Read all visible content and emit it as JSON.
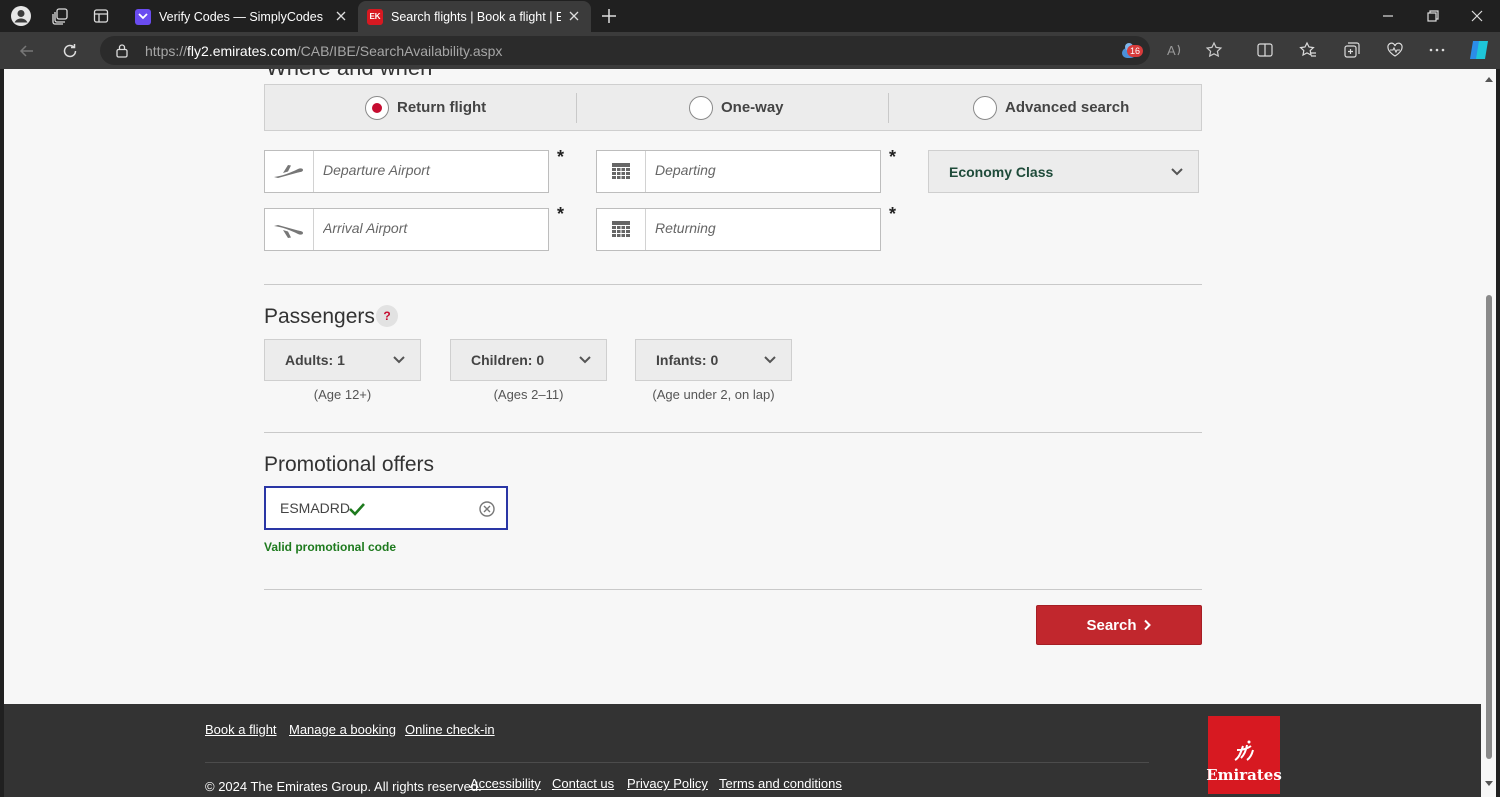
{
  "browser": {
    "tabs": [
      {
        "title": "Verify Codes — SimplyCodes",
        "active": false,
        "favicon": "simplycodes-icon",
        "color": "#6a4cf0"
      },
      {
        "title": "Search flights | Book a flight | Emirates",
        "active": true,
        "favicon": "emirates-ek-icon",
        "color": "#d71921",
        "favicon_text": "EK"
      }
    ],
    "url_prefix": "https://",
    "url_domain": "fly2.emirates.com",
    "url_path": "/CAB/IBE/SearchAvailability.aspx",
    "extensions_badge": "16"
  },
  "trip_type": {
    "options": [
      {
        "label": "Return flight",
        "selected": true
      },
      {
        "label": "One-way",
        "selected": false
      },
      {
        "label": "Advanced search",
        "selected": false
      }
    ]
  },
  "fields": {
    "departure_placeholder": "Departure Airport",
    "arrival_placeholder": "Arrival Airport",
    "departing_placeholder": "Departing",
    "returning_placeholder": "Returning",
    "required_mark": "*",
    "cabin_class": "Economy Class"
  },
  "passengers": {
    "title": "Passengers",
    "help": "?",
    "adults": {
      "label": "Adults: 1",
      "note": "(Age 12+)"
    },
    "children": {
      "label": "Children: 0",
      "note": "(Ages 2–11)"
    },
    "infants": {
      "label": "Infants: 0",
      "note": "(Age under 2, on lap)"
    }
  },
  "promo": {
    "title": "Promotional offers",
    "value": "ESMADRD",
    "status": "Valid promotional code"
  },
  "search_label": "Search",
  "footer": {
    "links_top": [
      "Book a flight",
      "Manage a booking",
      "Online check-in"
    ],
    "copyright": "© 2024 The Emirates Group. All rights reserved.",
    "links_bottom": [
      "Accessibility",
      "Contact us",
      "Privacy Policy",
      "Terms and conditions"
    ],
    "logo_text": "Emirates"
  },
  "colors": {
    "accent": "#c1272d",
    "valid": "#1e7a1e",
    "focus": "#2a36a5"
  }
}
